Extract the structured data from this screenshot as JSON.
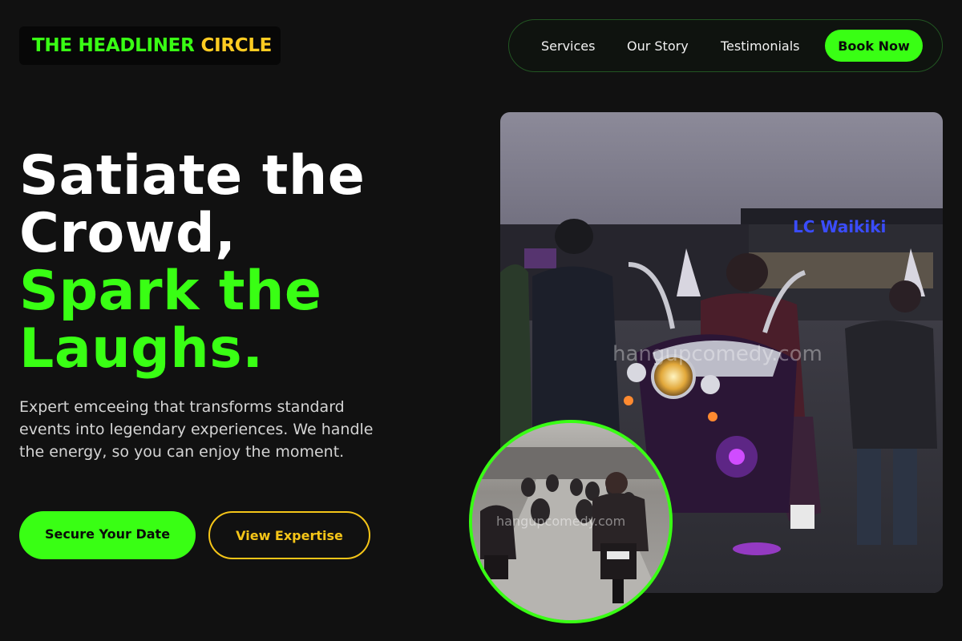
{
  "brand": {
    "name_part1": "THE HEADLINER",
    "name_part2": "CIRCLE",
    "primary_color": "#39ff14",
    "secondary_color": "#ffcc22"
  },
  "nav": {
    "links": [
      "Services",
      "Our Story",
      "Testimonials"
    ],
    "cta_label": "Book Now"
  },
  "hero": {
    "headline_line1": "Satiate the",
    "headline_line2": "Crowd,",
    "headline_line3": "Spark the",
    "headline_line4": "Laughs.",
    "description": "Expert emceeing that transforms standard events into legendary experiences. We handle the energy, so you can enjoy the moment.",
    "primary_cta": "Secure Your Date",
    "secondary_cta": "View Expertise"
  },
  "images": {
    "main_sign_text": "LC Waikiki",
    "main_watermark": "hangupcomedy.com",
    "inset_watermark": "hangupcomedy.com"
  }
}
